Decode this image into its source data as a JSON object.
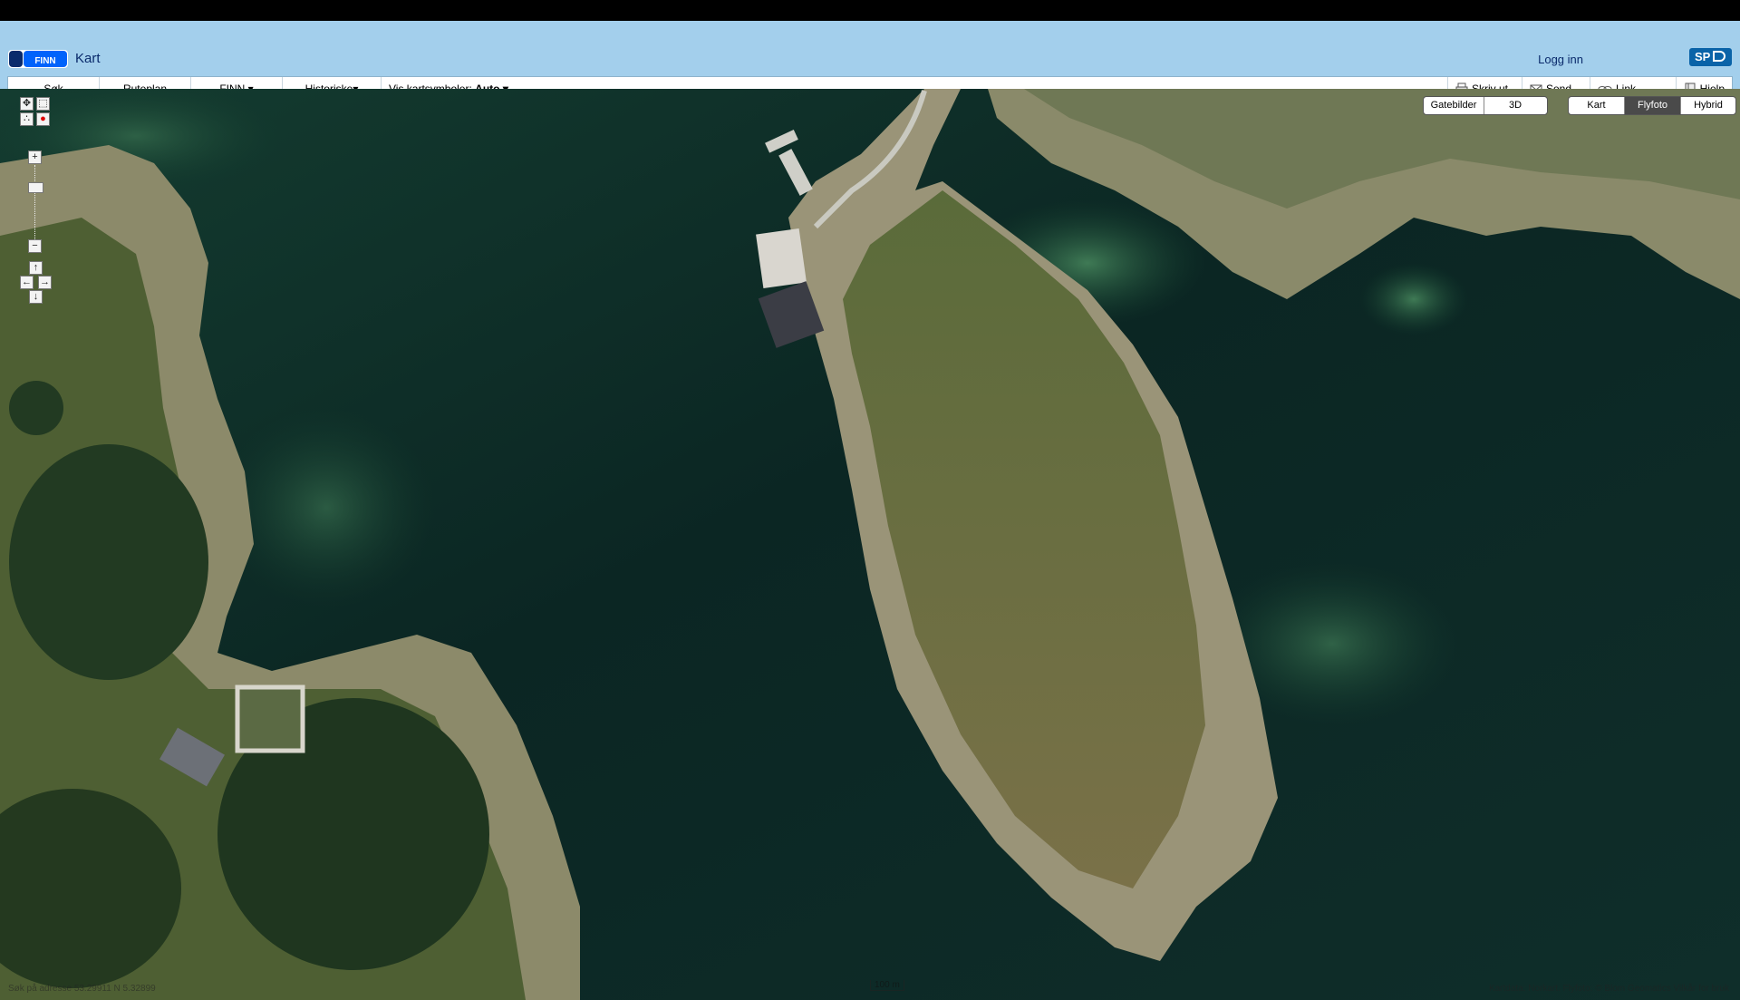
{
  "header": {
    "app_title": "Kart",
    "logo_text": "FINN",
    "login_label": "Logg inn",
    "partner_logo_text": "SP"
  },
  "toolbar": {
    "left_items": [
      {
        "label": "Søk"
      },
      {
        "label": "Ruteplan"
      },
      {
        "label": "FINN ▾"
      },
      {
        "label": "Historiske▾"
      }
    ],
    "map_symbols_label": "Vis kartsymboler:",
    "map_symbols_value": "Auto ▾",
    "right_items": [
      {
        "label": "Skriv ut",
        "icon": "printer-icon"
      },
      {
        "label": "Send",
        "icon": "envelope-icon"
      },
      {
        "label": "Link",
        "icon": "link-icon"
      },
      {
        "label": "Hjelp",
        "icon": "help-book-icon"
      }
    ]
  },
  "map_modes": {
    "view_buttons": [
      "Gatebilder",
      "3D"
    ],
    "layer_buttons": [
      "Kart",
      "Flyfoto",
      "Hybrid"
    ],
    "active_layer": "Flyfoto"
  },
  "controls": {
    "zoom_in": "+",
    "zoom_out": "−",
    "pan_up": "↑",
    "pan_down": "↓",
    "pan_left": "←",
    "pan_right": "→"
  },
  "footer": {
    "coordinates_text": "Søk på adresse    53.29911 N 5.32899",
    "scale_text": "100 m",
    "attribution_text": "Kartdata: Norkart. Flyfoto: © Blom Geomatics   Vilkår for bruk"
  }
}
